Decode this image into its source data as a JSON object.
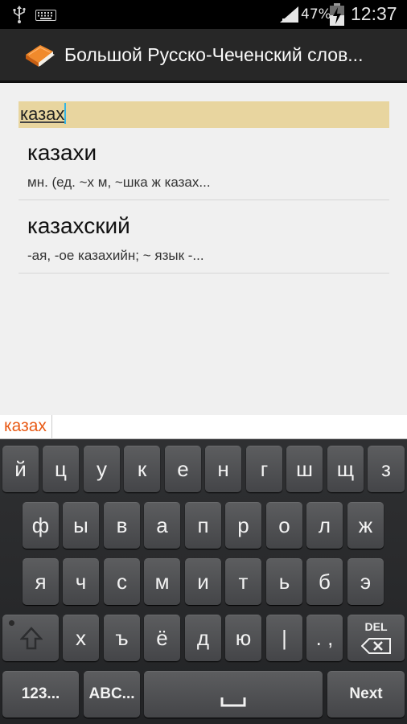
{
  "status": {
    "battery_percent": "47%",
    "time": "12:37",
    "icons": [
      "usb-icon",
      "keyboard-icon",
      "signal-icon",
      "battery-charging-icon"
    ]
  },
  "action_bar": {
    "title": "Большой Русско-Чеченский слов...",
    "icon": "book-icon"
  },
  "search": {
    "value": "казах"
  },
  "results": [
    {
      "word": "казахи",
      "definition": "мн. (ед. ~х м, ~шка ж казах..."
    },
    {
      "word": "казахский",
      "definition": "-ая, -ое казахийн; ~ язык -..."
    }
  ],
  "suggestion": "казах",
  "keyboard": {
    "row1": [
      "й",
      "ц",
      "у",
      "к",
      "е",
      "н",
      "г",
      "ш",
      "щ",
      "з"
    ],
    "row2": [
      "ф",
      "ы",
      "в",
      "а",
      "п",
      "р",
      "о",
      "л",
      "ж"
    ],
    "row3": [
      "я",
      "ч",
      "с",
      "м",
      "и",
      "т",
      "ь",
      "б",
      "э"
    ],
    "row4": [
      "х",
      "ъ",
      "ё",
      "д",
      "ю",
      "|",
      ". ,"
    ],
    "del_label": "DEL",
    "numbers_label": "123...",
    "abc_label": "ABC...",
    "next_label": "Next",
    "colors": {
      "accent": "#33b5e5",
      "suggestion": "#e85a15",
      "highlight": "#e8d59f"
    }
  }
}
